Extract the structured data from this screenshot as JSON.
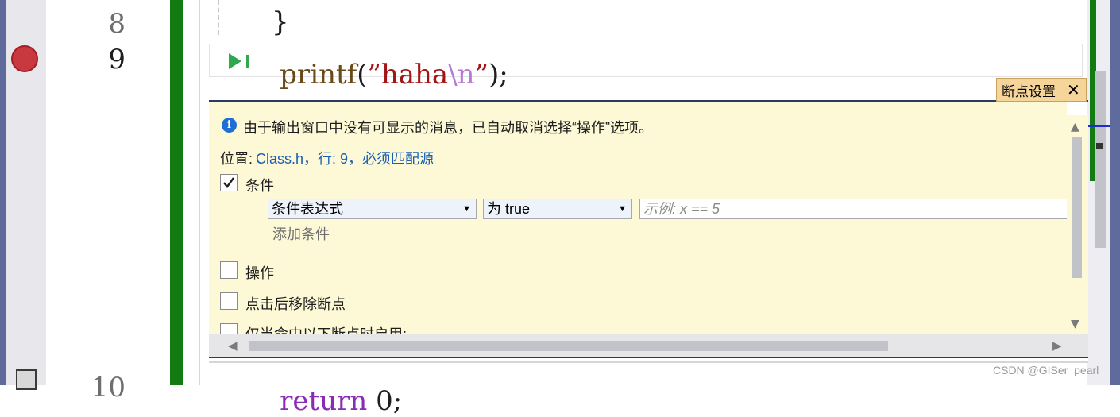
{
  "editor": {
    "line_numbers": [
      "8",
      "9",
      "10"
    ],
    "code_lines": {
      "line8": "}",
      "line9_func": "printf",
      "line9_open": "(",
      "line9_str_start": "”haha",
      "line9_escape": "\\n",
      "line9_str_end": "”",
      "line9_close": ");",
      "line10_keyword": "return",
      "line10_rest": " 0;"
    },
    "current_line_icon": "play-arrow-icon",
    "breakpoint_color": "#c8383f",
    "keyword_color": "#8a2bb5",
    "string_color": "#a31515",
    "escape_color": "#b77ad6"
  },
  "breakpoint_settings": {
    "tab_label": "断点设置",
    "close_icon": "✕",
    "info_message": "由于输出窗口中没有可显示的消息，已自动取消选择“操作”选项。",
    "location_label": "位置:",
    "location_value": "Class.h，行: 9，必须匹配源",
    "condition": {
      "label": "条件",
      "checked": true,
      "type_select": "条件表达式",
      "operator_select": "为 true",
      "expression_placeholder": "示例: x == 5",
      "add_condition": "添加条件"
    },
    "actions": {
      "label": "操作",
      "checked": false
    },
    "remove_after_hit": {
      "label": "点击后移除断点",
      "checked": false
    },
    "enable_only_when": {
      "label": "仅当命中以下断点时启用:",
      "checked": false
    }
  },
  "watermark": "CSDN @GISer_pearl"
}
